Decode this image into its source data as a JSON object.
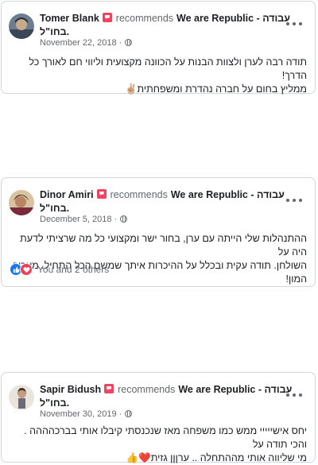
{
  "reviews": [
    {
      "name": "Tomer Blank",
      "recommends": "recommends",
      "page_part1": "We are Republic - עבודה",
      "page_part2": "בחו\"ל.",
      "date": "November 22, 2018 ·",
      "text_line1": "תודה רבה לערן ולצוות הבנות על הכוונה מקצועית וליווי חם לאורך כל הדרך!",
      "text_line2": "ממליץ בחום על חברה נהדרת ומשפחתית✌🏼"
    },
    {
      "name": "Dinor Amiri",
      "recommends": "recommends",
      "page_part1": "We are Republic - עבודה",
      "page_part2": "בחו\"ל.",
      "date": "December 5, 2018 ·",
      "text_line1": "ההתנהלות שלי הייתה עם ערן, בחור ישר ומקצועי כל מה שרציתי לדעת היה על",
      "text_line2": "השולחן. תודה עקית ובכלל על ההיכרות איתך שמשם הכל התחיל. מעריך המון!",
      "reactions_text": "You and 2 others"
    },
    {
      "name": "Sapir Bidush",
      "recommends": "recommends",
      "page_part1": "We are Republic - עבודה",
      "page_part2": "בחו\"ל.",
      "date": "November 30, 2019 ·",
      "text_line1": "יחס אישייייי ממש כמו משפחה מאז שנכנסתי קיבלו אותי בברכהההה . והכי תודה על",
      "text_line2": "מי שליווה אותי מההתחלה .. ערןןן גזית❤️👍"
    }
  ],
  "colors": {
    "badge": "#f3425f",
    "like": "#1877f2",
    "love": "#f33e58",
    "meta": "#65676b"
  },
  "icons": [
    "recommend-badge-icon",
    "globe-icon",
    "more-options-icon",
    "like-reaction-icon",
    "love-reaction-icon"
  ]
}
